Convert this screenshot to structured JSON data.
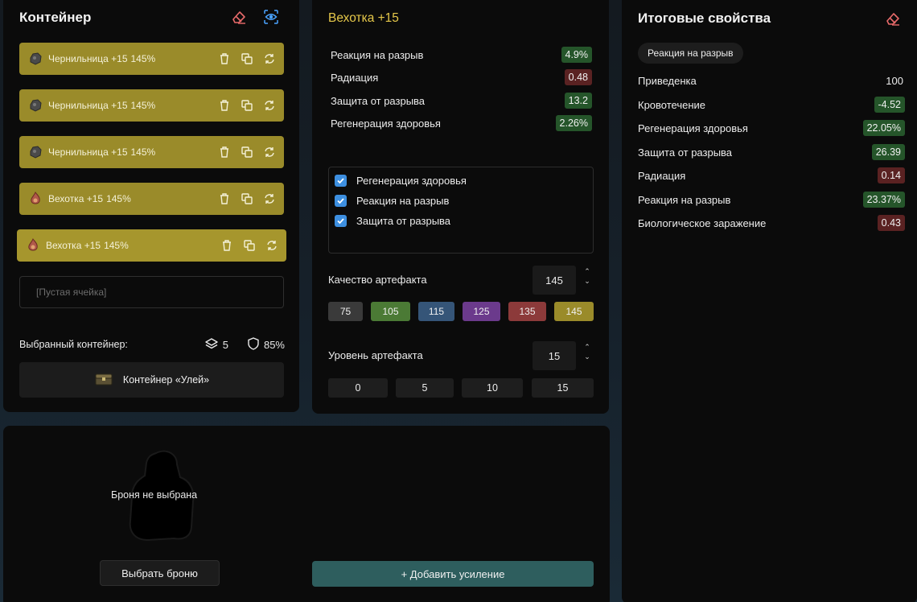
{
  "container_panel": {
    "title": "Контейнер",
    "slots": [
      {
        "name": "Чернильница +15",
        "quality": "145%",
        "icon": "rock-artifact-icon"
      },
      {
        "name": "Чернильница +15",
        "quality": "145%",
        "icon": "rock-artifact-icon"
      },
      {
        "name": "Чернильница +15",
        "quality": "145%",
        "icon": "rock-artifact-icon"
      },
      {
        "name": "Вехотка +15",
        "quality": "145%",
        "icon": "flame-artifact-icon"
      },
      {
        "name": "Вехотка +15",
        "quality": "145%",
        "icon": "flame-artifact-icon"
      }
    ],
    "empty_slot_text": "[Пустая ячейка]",
    "selected_label": "Выбранный контейнер:",
    "slot_count": "5",
    "protection": "85%",
    "container_name": "Контейнер «Улей»"
  },
  "artifact_panel": {
    "title": "Вехотка +15",
    "stats": [
      {
        "name": "Реакция на разрыв",
        "value": "4.9%",
        "tone": "good"
      },
      {
        "name": "Радиация",
        "value": "0.48",
        "tone": "bad"
      },
      {
        "name": "Защита от разрыва",
        "value": "13.2",
        "tone": "good"
      },
      {
        "name": "Регенерация здоровья",
        "value": "2.26%",
        "tone": "good"
      }
    ],
    "checks": [
      {
        "label": "Регенерация здоровья",
        "checked": true
      },
      {
        "label": "Реакция на разрыв",
        "checked": true
      },
      {
        "label": "Защита от разрыва",
        "checked": true
      }
    ],
    "quality_label": "Качество артефакта",
    "quality_value": "145",
    "quality_presets": [
      {
        "label": "75",
        "color": "#3a3a3a"
      },
      {
        "label": "105",
        "color": "#4b7a35"
      },
      {
        "label": "115",
        "color": "#355578"
      },
      {
        "label": "125",
        "color": "#6b3a8c"
      },
      {
        "label": "135",
        "color": "#8c3a3a"
      },
      {
        "label": "145",
        "color": "#9a8b2a"
      }
    ],
    "level_label": "Уровень артефакта",
    "level_value": "15",
    "level_presets": [
      "0",
      "5",
      "10",
      "15"
    ]
  },
  "totals_panel": {
    "title": "Итоговые свойства",
    "filter_chip": "Реакция на разрыв",
    "rows": [
      {
        "name": "Приведенка",
        "value": "100",
        "tone": "plain"
      },
      {
        "name": "Кровотечение",
        "value": "-4.52",
        "tone": "good"
      },
      {
        "name": "Регенерация здоровья",
        "value": "22.05%",
        "tone": "good"
      },
      {
        "name": "Защита от разрыва",
        "value": "26.39",
        "tone": "good"
      },
      {
        "name": "Радиация",
        "value": "0.14",
        "tone": "bad"
      },
      {
        "name": "Реакция на разрыв",
        "value": "23.37%",
        "tone": "good"
      },
      {
        "name": "Биологическое заражение",
        "value": "0.43",
        "tone": "bad"
      }
    ]
  },
  "armor_panel": {
    "empty_text": "Броня не выбрана",
    "pick_button": "Выбрать броню",
    "add_boost_button": "+ Добавить усиление"
  },
  "colors": {
    "slot_gold": "#9a8b2a",
    "positive": "#25552a",
    "negative": "#5a2222",
    "accent_title": "#e6c84a",
    "checkbox_blue": "#3d8fe0",
    "boost_teal": "#2e5e5e"
  }
}
